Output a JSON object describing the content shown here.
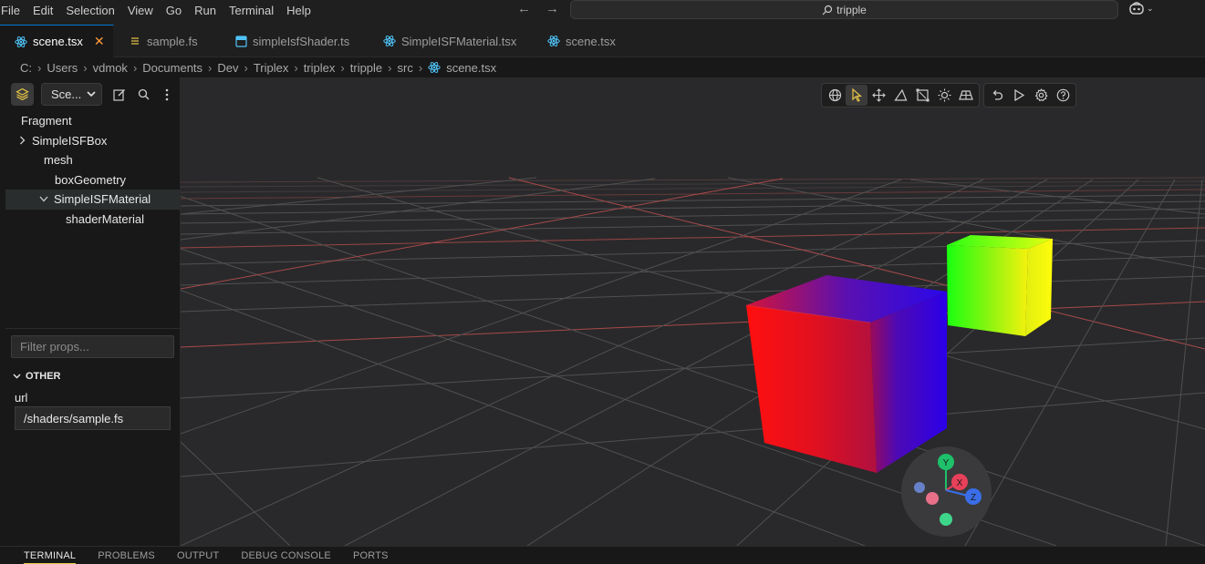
{
  "menu": [
    "File",
    "Edit",
    "Selection",
    "View",
    "Go",
    "Run",
    "Terminal",
    "Help"
  ],
  "search": {
    "text": "tripple"
  },
  "tabs": [
    {
      "label": "scene.tsx",
      "icon": "react-icon",
      "active": true
    },
    {
      "label": "sample.fs",
      "icon": "lines-icon"
    },
    {
      "label": "simpleIsfShader.ts",
      "icon": "ts-file-icon"
    },
    {
      "label": "SimpleISFMaterial.tsx",
      "icon": "react-icon"
    },
    {
      "label": "scene.tsx",
      "icon": "react-icon"
    }
  ],
  "breadcrumb": [
    "C:",
    "Users",
    "vdmok",
    "Documents",
    "Dev",
    "Triplex",
    "triplex",
    "tripple",
    "src",
    "scene.tsx"
  ],
  "scene_panel": {
    "select_value": "Sce...",
    "tree": [
      {
        "label": "Fragment",
        "indent": 0,
        "chevron": ""
      },
      {
        "label": "SimpleISFBox",
        "indent": 1,
        "chevron": "right"
      },
      {
        "label": "mesh",
        "indent": 1,
        "chevron": ""
      },
      {
        "label": "boxGeometry",
        "indent": 2,
        "chevron": ""
      },
      {
        "label": "SimpleISFMaterial",
        "indent": 2,
        "chevron": "down",
        "selected": true
      },
      {
        "label": "shaderMaterial",
        "indent": 3,
        "chevron": ""
      }
    ],
    "filter_placeholder": "Filter props...",
    "section_title": "OTHER",
    "prop_label": "url",
    "prop_value": "/shaders/sample.fs"
  },
  "gizmo": {
    "x": "X",
    "y": "Y",
    "z": "Z"
  },
  "bottom_tabs": [
    "TERMINAL",
    "PROBLEMS",
    "OUTPUT",
    "DEBUG CONSOLE",
    "PORTS"
  ],
  "colors": {
    "accent": "#0078d4",
    "active_tab_close": "#ff9a3c",
    "terminal_underline": "#e7c94a"
  }
}
